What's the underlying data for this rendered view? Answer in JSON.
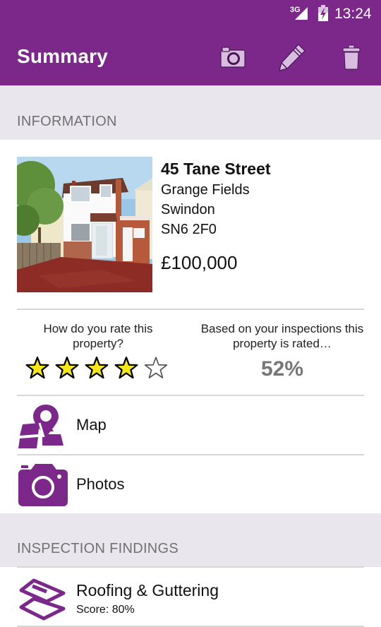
{
  "status_bar": {
    "network": "3G",
    "time": "13:24"
  },
  "app_bar": {
    "title": "Summary",
    "actions": [
      {
        "name": "camera-icon",
        "label": "Add photo"
      },
      {
        "name": "pencil-icon",
        "label": "Edit"
      },
      {
        "name": "trash-icon",
        "label": "Delete"
      }
    ]
  },
  "colors": {
    "brand": "#7b288a",
    "star_filled": "#f5e71a",
    "section_bg": "#e9e7ed"
  },
  "information": {
    "header": "INFORMATION",
    "property": {
      "street": "45 Tane Street",
      "area": "Grange Fields",
      "town": "Swindon",
      "postcode": "SN6 2F0",
      "price": "£100,000"
    },
    "user_rating": {
      "question": "How do you rate this property?",
      "value": 4,
      "max": 5
    },
    "inspection_rating": {
      "caption": "Based on your inspections this property is rated…",
      "value": "52%"
    },
    "links": [
      {
        "icon": "map-pin-icon",
        "label": "Map"
      },
      {
        "icon": "camera-icon",
        "label": "Photos"
      }
    ]
  },
  "inspection_findings": {
    "header": "INSPECTION FINDINGS",
    "items": [
      {
        "icon": "roof-tiles-icon",
        "name": "Roofing & Guttering",
        "score": "Score: 80%"
      }
    ]
  }
}
